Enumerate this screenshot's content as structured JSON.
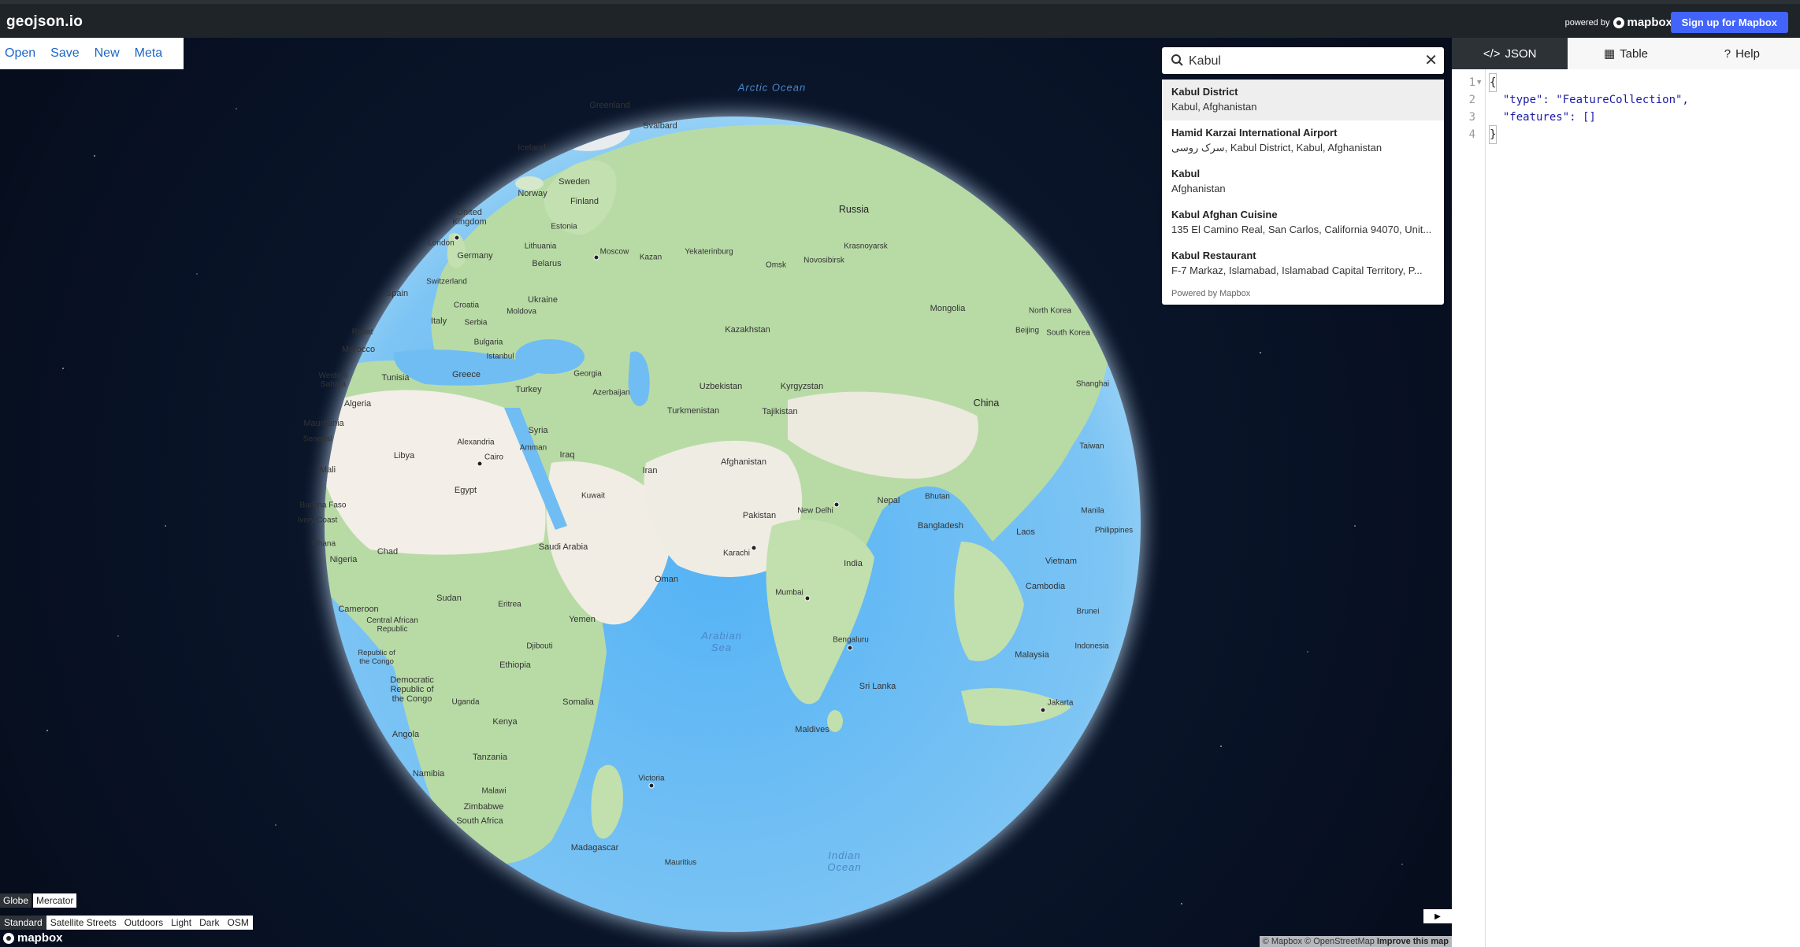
{
  "header": {
    "app_title": "geojson.io",
    "powered_by": "powered by",
    "mapbox_brand": "mapbox",
    "signup_label": "Sign up for Mapbox"
  },
  "menu": {
    "open": "Open",
    "save": "Save",
    "new": "New",
    "meta": "Meta"
  },
  "search": {
    "value": "Kabul",
    "clear_glyph": "✕",
    "results": [
      {
        "title": "Kabul District",
        "subtitle": "Kabul, Afghanistan"
      },
      {
        "title": "Hamid Karzai International Airport",
        "subtitle": "سرک روسی, Kabul District, Kabul, Afghanistan"
      },
      {
        "title": "Kabul",
        "subtitle": "Afghanistan"
      },
      {
        "title": "Kabul Afghan Cuisine",
        "subtitle": "135 El Camino Real, San Carlos, California 94070, Unit..."
      },
      {
        "title": "Kabul Restaurant",
        "subtitle": "F-7 Markaz, Islamabad, Islamabad Capital Territory, P..."
      }
    ],
    "powered_by": "Powered by Mapbox"
  },
  "map": {
    "labels": {
      "arctic_ocean": "Arctic Ocean",
      "greenland": "Greenland",
      "svalbard": "Svalbard",
      "iceland": "Iceland",
      "sweden": "Sweden",
      "norway": "Norway",
      "finland": "Finland",
      "united_kingdom": "United Kingdom",
      "london": "London",
      "estonia": "Estonia",
      "russia": "Russia",
      "moscow": "Moscow",
      "kazan": "Kazan",
      "yekaterinburg": "Yekaterinburg",
      "omsk": "Omsk",
      "novosibirsk": "Novosibirsk",
      "krasnoyarsk": "Krasnoyarsk",
      "germany": "Germany",
      "lithuania": "Lithuania",
      "belarus": "Belarus",
      "switzerland": "Switzerland",
      "spain": "Spain",
      "croatia": "Croatia",
      "moldova": "Moldova",
      "ukraine": "Ukraine",
      "italy": "Italy",
      "serbia": "Serbia",
      "rabat": "Rabat",
      "bulgaria": "Bulgaria",
      "morocco": "Morocco",
      "istanbul": "Istanbul",
      "tunisia": "Tunisia",
      "greece": "Greece",
      "georgia": "Georgia",
      "azerbaijan": "Azerbaijan",
      "western_sahara": "Western Sahara",
      "turkey": "Turkey",
      "kazakhstan": "Kazakhstan",
      "mongolia": "Mongolia",
      "north_korea": "North Korea",
      "beijing": "Beijing",
      "south_korea": "South Korea",
      "uzbekistan": "Uzbekistan",
      "kyrgyzstan": "Kyrgyzstan",
      "algeria": "Algeria",
      "turkmenistan": "Turkmenistan",
      "tajikistan": "Tajikistan",
      "shanghai": "Shanghai",
      "china": "China",
      "mauritania": "Mauritania",
      "syria": "Syria",
      "senegal": "Senegal",
      "alexandria": "Alexandria",
      "amman": "Amman",
      "cairo": "Cairo",
      "libya": "Libya",
      "iraq": "Iraq",
      "afghanistan": "Afghanistan",
      "taiwan": "Taiwan",
      "mali": "Mali",
      "iran": "Iran",
      "egypt": "Egypt",
      "kuwait": "Kuwait",
      "nepal": "Nepal",
      "bhutan": "Bhutan",
      "burkina_faso": "Burkina Faso",
      "new_delhi": "New Delhi",
      "pakistan": "Pakistan",
      "manila": "Manila",
      "ivory_coast": "Ivory Coast",
      "bangladesh": "Bangladesh",
      "philippines": "Philippines",
      "laos": "Laos",
      "ghana": "Ghana",
      "chad": "Chad",
      "saudi_arabia": "Saudi Arabia",
      "karachi": "Karachi",
      "nigeria": "Nigeria",
      "india": "India",
      "vietnam": "Vietnam",
      "oman": "Oman",
      "sudan": "Sudan",
      "cambodia": "Cambodia",
      "mumbai": "Mumbai",
      "eritrea": "Eritrea",
      "cameroon": "Cameroon",
      "brunei": "Brunei",
      "central_african_republic": "Central African Republic",
      "yemen": "Yemen",
      "arabian_sea": "Arabian Sea",
      "djibouti": "Djibouti",
      "bengaluru": "Bengaluru",
      "indonesia": "Indonesia",
      "republic_of_the_congo": "Republic of the Congo",
      "malaysia": "Malaysia",
      "ethiopia": "Ethiopia",
      "drc": "Democratic Republic of the Congo",
      "sri_lanka": "Sri Lanka",
      "somalia": "Somalia",
      "uganda": "Uganda",
      "jakarta": "Jakarta",
      "kenya": "Kenya",
      "angola": "Angola",
      "maldives": "Maldives",
      "tanzania": "Tanzania",
      "namibia": "Namibia",
      "victoria": "Victoria",
      "malawi": "Malawi",
      "zimbabwe": "Zimbabwe",
      "south_africa": "South Africa",
      "madagascar": "Madagascar",
      "indian_ocean": "Indian Ocean",
      "mauritius": "Mauritius"
    },
    "projection_options": [
      "Globe",
      "Mercator"
    ],
    "projection_selected": "Globe",
    "style_options": [
      "Standard",
      "Satellite Streets",
      "Outdoors",
      "Light",
      "Dark",
      "OSM"
    ],
    "style_selected": "Standard",
    "bottom_logo": "mapbox",
    "attribution": {
      "mapbox": "© Mapbox",
      "osm": "© OpenStreetMap",
      "improve": "Improve this map"
    },
    "colors": {
      "ocean": "#5fb3f0",
      "land_green": "#b7dca5",
      "land_desert": "#f3eee7",
      "space": "#081225"
    }
  },
  "panel": {
    "tabs": [
      {
        "icon": "</>",
        "label": "JSON"
      },
      {
        "icon": "▦",
        "label": "Table"
      },
      {
        "icon": "?",
        "label": "Help"
      }
    ],
    "code_lines": [
      {
        "n": "1",
        "fold": "▼",
        "text": "{"
      },
      {
        "n": "2",
        "fold": "",
        "text": "  \"type\": \"FeatureCollection\","
      },
      {
        "n": "3",
        "fold": "",
        "text": "  \"features\": []"
      },
      {
        "n": "4",
        "fold": "",
        "text": "}"
      }
    ]
  }
}
